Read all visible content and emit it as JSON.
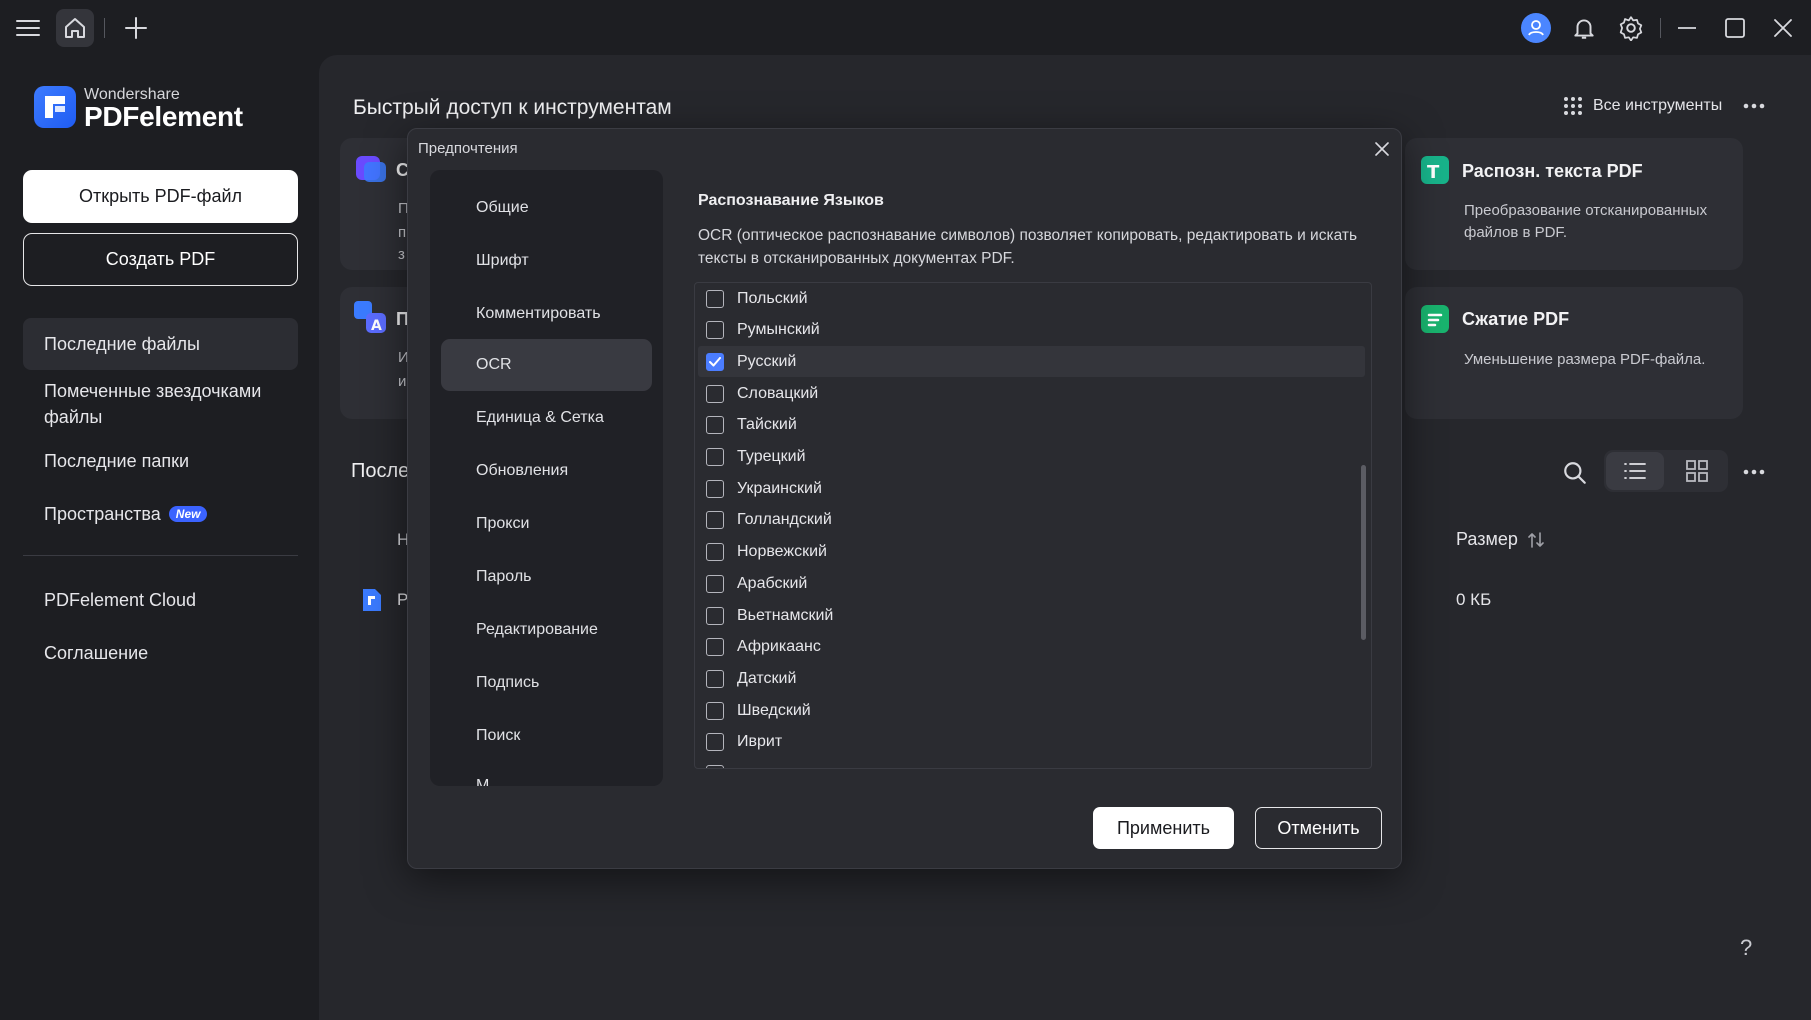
{
  "topbar": {
    "icons": [
      "menu-icon",
      "home-icon",
      "plus-icon",
      "avatar-icon",
      "bell-icon",
      "gear-icon",
      "minimize-icon",
      "maximize-icon",
      "close-icon"
    ]
  },
  "sidebar": {
    "brand_small": "Wondershare",
    "brand_big": "PDFelement",
    "open_btn": "Открыть PDF-файл",
    "create_btn": "Создать PDF",
    "items": [
      {
        "label": "Последние файлы"
      },
      {
        "label": "Помеченные звездочками файлы"
      },
      {
        "label": "Последние папки"
      },
      {
        "label": "Пространства",
        "badge": "New"
      },
      {
        "label": "PDFelement Cloud"
      },
      {
        "label": "Соглашение"
      }
    ]
  },
  "main": {
    "quick_access_title": "Быстрый доступ к инструментам",
    "all_tools": "Все инструменты",
    "left_cards": [
      {
        "title": "С",
        "desc_lines": [
          "П",
          "п",
          "з"
        ]
      },
      {
        "title": "П",
        "desc_lines": [
          "И",
          "и"
        ]
      }
    ],
    "cards": [
      {
        "title": "Распозн. текста PDF",
        "desc": "Преобразование отсканированных файлов в PDF."
      },
      {
        "title": "Сжатие PDF",
        "desc": "Уменьшение размера PDF-файла."
      }
    ],
    "recent_title": "После",
    "col_name": "Н",
    "file_name": "Р",
    "size_header": "Размер",
    "size_value": "0 КБ",
    "help": "?"
  },
  "dialog": {
    "title": "Предпочтения",
    "nav": [
      "Общие",
      "Шрифт",
      "Комментировать",
      "OCR",
      "Единица & Сетка",
      "Обновления",
      "Прокси",
      "Пароль",
      "Редактирование",
      "Подпись",
      "Поиск",
      "М"
    ],
    "active_nav": 3,
    "section_title": "Распознавание Языков",
    "section_desc": "OCR (оптическое распознавание символов) позволяет копировать, редактировать и искать тексты в отсканированных документах PDF.",
    "languages": [
      {
        "label": "Польский",
        "checked": false
      },
      {
        "label": "Румынский",
        "checked": false
      },
      {
        "label": "Русский",
        "checked": true
      },
      {
        "label": "Словацкий",
        "checked": false
      },
      {
        "label": "Тайский",
        "checked": false
      },
      {
        "label": "Турецкий",
        "checked": false
      },
      {
        "label": "Украинский",
        "checked": false
      },
      {
        "label": "Голландский",
        "checked": false
      },
      {
        "label": "Норвежский",
        "checked": false
      },
      {
        "label": "Арабский",
        "checked": false
      },
      {
        "label": "Вьетнамский",
        "checked": false
      },
      {
        "label": "Африкаанс",
        "checked": false
      },
      {
        "label": "Датский",
        "checked": false
      },
      {
        "label": "Шведский",
        "checked": false
      },
      {
        "label": "Иврит",
        "checked": false
      }
    ],
    "apply_btn": "Применить",
    "cancel_btn": "Отменить"
  },
  "colors": {
    "accent": "#4b7dff",
    "background": "#1d1e22",
    "panel": "#26272c",
    "dialog": "#2a2b30"
  }
}
